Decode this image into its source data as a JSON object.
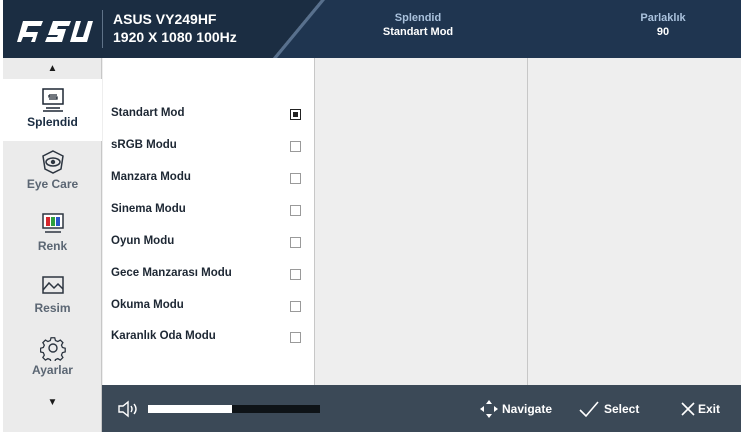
{
  "header": {
    "brand": "ASUS",
    "model": "ASUS VY249HF",
    "resolution": "1920 X 1080 100Hz",
    "splendid_label": "Splendid",
    "splendid_value": "Standart Mod",
    "brightness_label": "Parlaklık",
    "brightness_value": "90",
    "colors": {
      "dark": "#1b2d42",
      "light": "#ededed",
      "accent_text": "#a9c1dc"
    }
  },
  "sidebar": {
    "items": [
      {
        "label": "Splendid",
        "icon": "monitor-icon",
        "active": true
      },
      {
        "label": "Eye Care",
        "icon": "eye-icon",
        "active": false
      },
      {
        "label": "Renk",
        "icon": "color-bars-icon",
        "active": false
      },
      {
        "label": "Resim",
        "icon": "picture-icon",
        "active": false
      },
      {
        "label": "Ayarlar",
        "icon": "gear-icon",
        "active": false
      }
    ],
    "up_arrow": "▲",
    "down_arrow": "▼"
  },
  "menu": {
    "options": [
      {
        "label": "Standart Mod",
        "selected": true
      },
      {
        "label": "sRGB Modu",
        "selected": false
      },
      {
        "label": "Manzara Modu",
        "selected": false
      },
      {
        "label": "Sinema Modu",
        "selected": false
      },
      {
        "label": "Oyun Modu",
        "selected": false
      },
      {
        "label": "Gece Manzarası Modu",
        "selected": false
      },
      {
        "label": "Okuma Modu",
        "selected": false
      },
      {
        "label": "Karanlık Oda Modu",
        "selected": false
      }
    ]
  },
  "footer": {
    "volume_level": 0.49,
    "navigate_label": "Navigate",
    "select_label": "Select",
    "exit_label": "Exit",
    "color": "#3b4957"
  }
}
